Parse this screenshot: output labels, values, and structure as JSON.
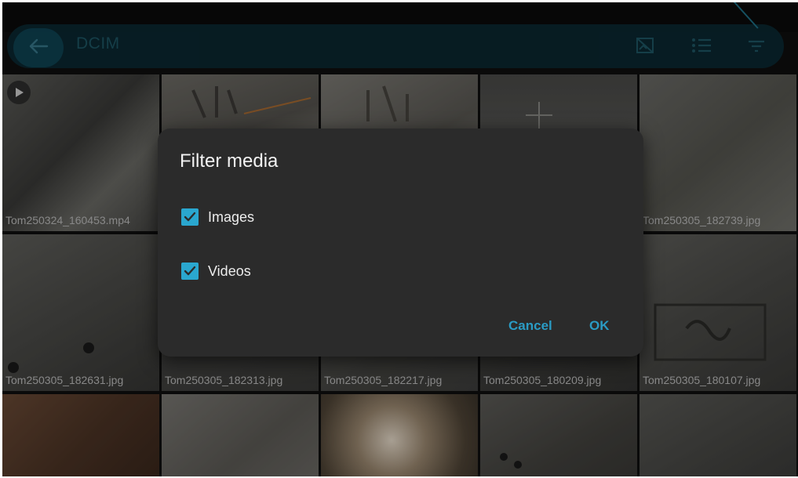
{
  "appbar": {
    "title": "DCIM",
    "back_icon": "arrow-left-icon",
    "icons": [
      "no-image-icon",
      "list-view-icon",
      "filter-icon"
    ]
  },
  "grid": {
    "row1": [
      {
        "caption": "Tom250324_160453.mp4",
        "is_video": true
      },
      {
        "caption": ""
      },
      {
        "caption": ""
      },
      {
        "caption": ""
      },
      {
        "caption": "Tom250305_182739.jpg"
      }
    ],
    "row2": [
      {
        "caption": "Tom250305_182631.jpg"
      },
      {
        "caption": "Tom250305_182313.jpg"
      },
      {
        "caption": "Tom250305_182217.jpg"
      },
      {
        "caption": "Tom250305_180209.jpg"
      },
      {
        "caption": "Tom250305_180107.jpg"
      }
    ]
  },
  "dialog": {
    "title": "Filter media",
    "options": [
      {
        "label": "Images",
        "checked": true
      },
      {
        "label": "Videos",
        "checked": true
      }
    ],
    "cancel_label": "Cancel",
    "ok_label": "OK"
  },
  "colors": {
    "accent": "#2aa7cf",
    "dialog_bg": "#2b2b2b",
    "appbar_bg": "#0b2a33"
  }
}
